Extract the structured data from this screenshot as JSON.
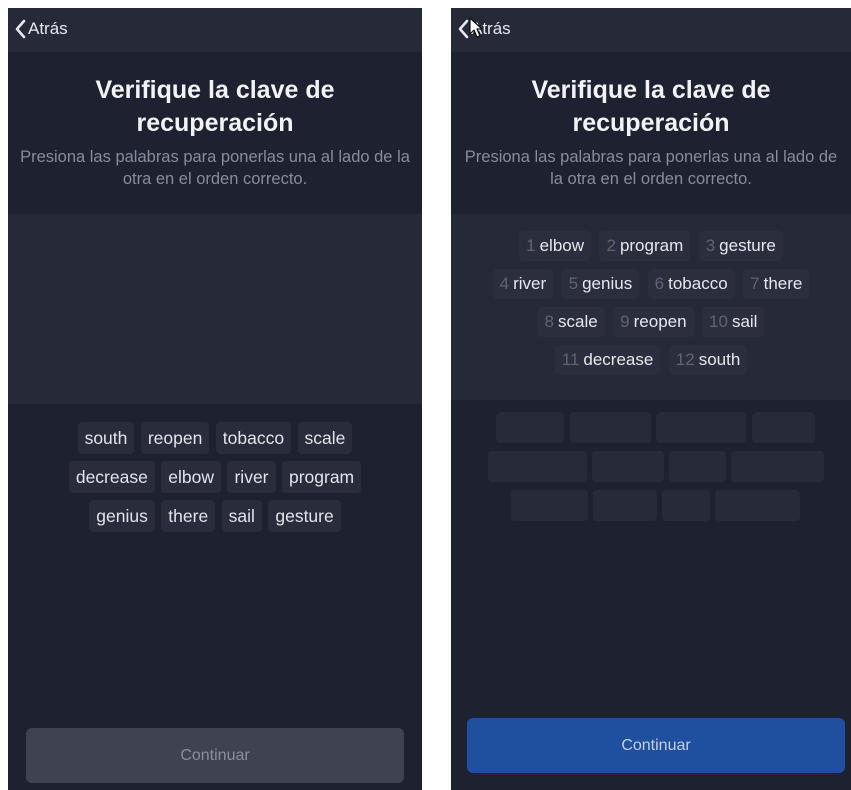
{
  "left": {
    "back_label": "Atrás",
    "title": "Verifique la clave de recuperación",
    "subtitle": "Presiona las palabras para ponerlas una al lado de la otra en el orden correcto.",
    "word_rows": [
      [
        "south",
        "reopen",
        "tobacco",
        "scale"
      ],
      [
        "decrease",
        "elbow",
        "river",
        "program"
      ],
      [
        "genius",
        "there",
        "sail",
        "gesture"
      ]
    ],
    "continue_label": "Continuar"
  },
  "right": {
    "back_label": "Atrás",
    "title": "Verifique la clave de recuperación",
    "subtitle": "Presiona las palabras para ponerlas una al lado de la otra en el orden correcto.",
    "selected_rows": [
      [
        {
          "num": "1",
          "word": "elbow"
        },
        {
          "num": "2",
          "word": "program"
        },
        {
          "num": "3",
          "word": "gesture"
        }
      ],
      [
        {
          "num": "4",
          "word": "river"
        },
        {
          "num": "5",
          "word": "genius"
        },
        {
          "num": "6",
          "word": "tobacco"
        },
        {
          "num": "7",
          "word": "there"
        }
      ],
      [
        {
          "num": "8",
          "word": "scale"
        },
        {
          "num": "9",
          "word": "reopen"
        },
        {
          "num": "10",
          "word": "sail"
        }
      ],
      [
        {
          "num": "11",
          "word": "decrease"
        },
        {
          "num": "12",
          "word": "south"
        }
      ]
    ],
    "continue_label": "Continuar"
  },
  "colors": {
    "background": "#1e2130",
    "topbar": "#252938",
    "chip": "#282c3b",
    "continue_disabled": "#3f4351",
    "continue_enabled": "#1f4f9f"
  }
}
